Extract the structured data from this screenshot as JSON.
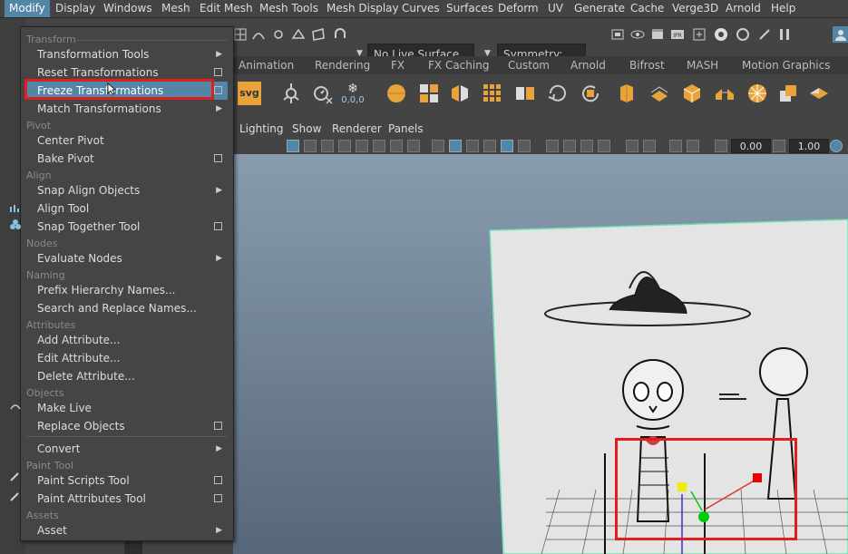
{
  "menubar": {
    "items": [
      "Modify",
      "Display",
      "Windows",
      "Mesh",
      "Edit Mesh",
      "Mesh Tools",
      "Mesh Display",
      "Curves",
      "Surfaces",
      "Deform",
      "UV",
      "Generate",
      "Cache",
      "Verge3D",
      "Arnold",
      "Help"
    ],
    "active": "Modify"
  },
  "toolbar": {
    "live_surface": "No Live Surface",
    "symmetry": "Symmetry: Off"
  },
  "shelf_tabs": [
    "Animation",
    "Rendering",
    "FX",
    "FX Caching",
    "Custom",
    "Arnold",
    "Bifrost",
    "MASH",
    "Motion Graphics"
  ],
  "shelf": {
    "svg_label": "svg",
    "xyz_label": "0,0,0"
  },
  "panel_menu": [
    "Lighting",
    "Show",
    "Renderer",
    "Panels"
  ],
  "viewport_fields": {
    "value1": "0.00",
    "value2": "1.00"
  },
  "modify_menu": {
    "sections": {
      "transform": "Transform",
      "pivot": "Pivot",
      "align": "Align",
      "nodes": "Nodes",
      "naming": "Naming",
      "attributes": "Attributes",
      "objects": "Objects",
      "paint_tool": "Paint Tool",
      "assets": "Assets"
    },
    "items": {
      "transformation_tools": "Transformation Tools",
      "reset_transformations": "Reset Transformations",
      "freeze_transformations": "Freeze Transformations",
      "match_transformations": "Match Transformations",
      "center_pivot": "Center Pivot",
      "bake_pivot": "Bake Pivot",
      "snap_align_objects": "Snap Align Objects",
      "align_tool": "Align Tool",
      "snap_together_tool": "Snap Together Tool",
      "evaluate_nodes": "Evaluate Nodes",
      "prefix_hierarchy_names": "Prefix Hierarchy Names...",
      "search_replace_names": "Search and Replace Names...",
      "add_attribute": "Add Attribute...",
      "edit_attribute": "Edit Attribute...",
      "delete_attribute": "Delete Attribute...",
      "make_live": "Make Live",
      "replace_objects": "Replace Objects",
      "convert": "Convert",
      "paint_scripts_tool": "Paint Scripts Tool",
      "paint_attributes_tool": "Paint Attributes Tool",
      "asset": "Asset"
    },
    "highlighted": "Freeze Transformations"
  },
  "colors": {
    "accent": "#5285a6",
    "annotation": "#e01e1e"
  }
}
